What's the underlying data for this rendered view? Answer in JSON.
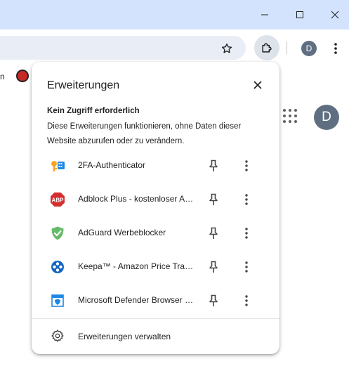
{
  "window": {
    "minimize_icon": "minimize-icon",
    "maximize_icon": "maximize-icon",
    "close_icon": "close-icon"
  },
  "toolbar": {
    "bookmark_star_icon": "star-icon",
    "extensions_icon": "puzzle-icon",
    "profile_initial": "D",
    "menu_icon": "more-vert-icon"
  },
  "bookmarks": {
    "partial_text": "n"
  },
  "page": {
    "avatar_initial": "D"
  },
  "popup": {
    "title": "Erweiterungen",
    "section_title": "Kein Zugriff erforderlich",
    "section_desc": "Diese Erweiterungen funktionieren, ohne Daten dieser Website abzurufen oder zu verändern.",
    "extensions": [
      {
        "name": "2FA-Authenticator",
        "icon": "key-icon"
      },
      {
        "name": "Adblock Plus - kostenloser Ad Blocker",
        "icon": "abp-icon"
      },
      {
        "name": "AdGuard Werbeblocker",
        "icon": "shield-check-icon"
      },
      {
        "name": "Keepa™ - Amazon Price Tracker",
        "icon": "keepa-icon"
      },
      {
        "name": "Microsoft Defender Browser Protection",
        "icon": "defender-icon"
      }
    ],
    "manage_label": "Erweiterungen verwalten"
  },
  "colors": {
    "titlebar": "#d3e3fd",
    "avatar": "#5f6f81"
  }
}
